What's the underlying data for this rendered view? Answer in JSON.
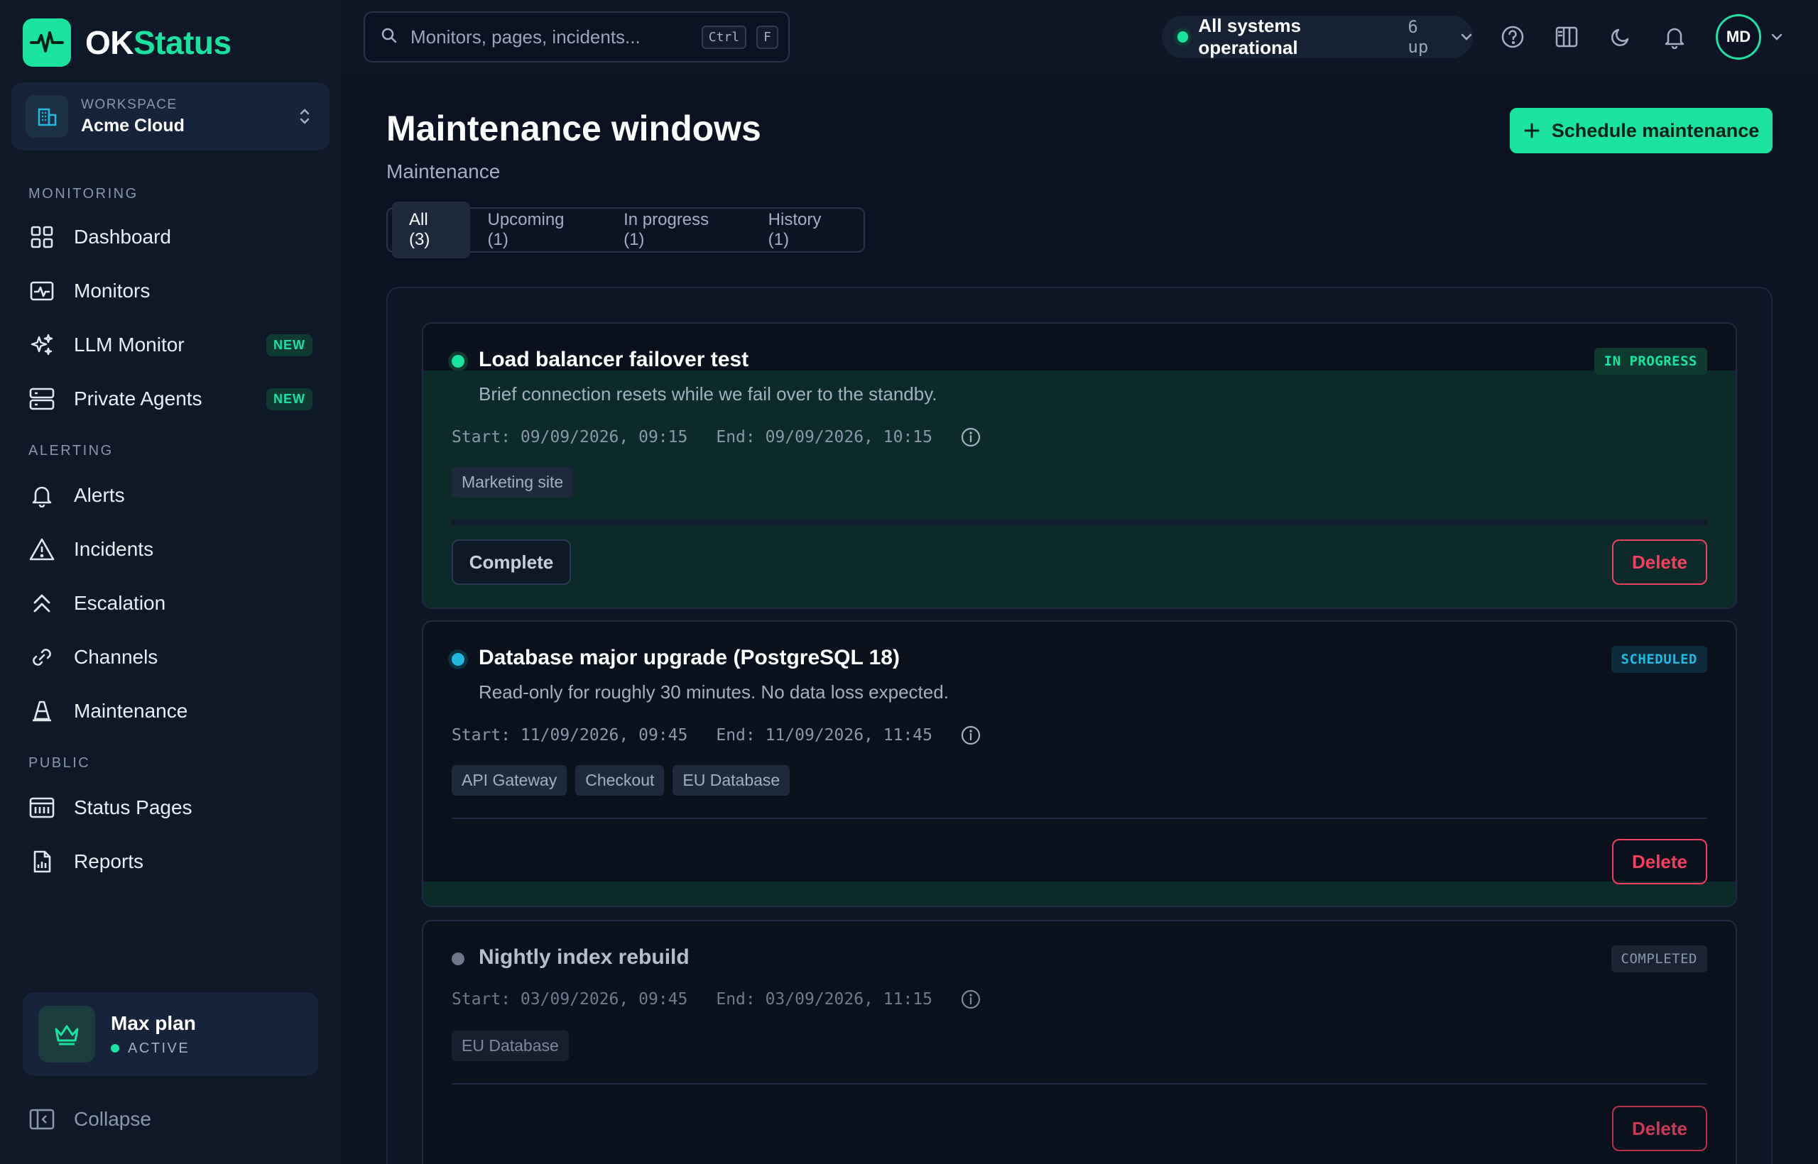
{
  "brand": {
    "name_a": "OK",
    "name_b": "Status",
    "accent": "#19e39f"
  },
  "workspace": {
    "label": "WORKSPACE",
    "name": "Acme Cloud"
  },
  "sidebar": {
    "sections": [
      "MONITORING",
      "ALERTING",
      "PUBLIC"
    ],
    "items": [
      {
        "label": "Dashboard",
        "icon": "grid-icon"
      },
      {
        "label": "Monitors",
        "icon": "pulse-monitor-icon"
      },
      {
        "label": "LLM Monitor",
        "icon": "sparkles-icon",
        "badge": "NEW"
      },
      {
        "label": "Private Agents",
        "icon": "server-icon",
        "badge": "NEW"
      },
      {
        "label": "Alerts",
        "icon": "bell-icon"
      },
      {
        "label": "Incidents",
        "icon": "warning-icon"
      },
      {
        "label": "Escalation",
        "icon": "chevrons-up-icon"
      },
      {
        "label": "Channels",
        "icon": "link-icon"
      },
      {
        "label": "Maintenance",
        "icon": "cone-icon"
      },
      {
        "label": "Status Pages",
        "icon": "calendar-grid-icon"
      },
      {
        "label": "Reports",
        "icon": "report-icon"
      }
    ],
    "plan": {
      "name": "Max plan",
      "status": "ACTIVE"
    },
    "collapse_label": "Collapse"
  },
  "topbar": {
    "search_placeholder": "Monitors, pages, incidents...",
    "kbd_ctrl": "Ctrl",
    "kbd_f": "F",
    "system_status": "All systems operational",
    "up_count": "6 up",
    "avatar_initials": "MD"
  },
  "page": {
    "title": "Maintenance windows",
    "subtitle": "Maintenance",
    "primary_action": "Schedule maintenance",
    "tabs": [
      "All (3)",
      "Upcoming (1)",
      "In progress (1)",
      "History (1)"
    ],
    "active_tab": "All (3)"
  },
  "windows": [
    {
      "title": "Load balancer failover test",
      "description": "Brief connection resets while we fail over to the standby.",
      "start": "Start: 09/09/2026, 09:15",
      "end": "End: 09/09/2026, 10:15",
      "status": "IN PROGRESS",
      "status_color": "#19e39f",
      "tags": [
        "Marketing site"
      ],
      "complete_label": "Complete",
      "delete_label": "Delete"
    },
    {
      "title": "Database major upgrade (PostgreSQL 18)",
      "description": "Read-only for roughly 30 minutes. No data loss expected.",
      "start": "Start: 11/09/2026, 09:45",
      "end": "End: 11/09/2026, 11:45",
      "status": "SCHEDULED",
      "status_color": "#22b8e0",
      "tags": [
        "API Gateway",
        "Checkout",
        "EU Database"
      ],
      "delete_label": "Delete"
    },
    {
      "title": "Nightly index rebuild",
      "start": "Start: 03/09/2026, 09:45",
      "end": "End: 03/09/2026, 11:15",
      "status": "COMPLETED",
      "status_color": "#8a97ab",
      "tags": [
        "EU Database"
      ],
      "delete_label": "Delete"
    }
  ]
}
